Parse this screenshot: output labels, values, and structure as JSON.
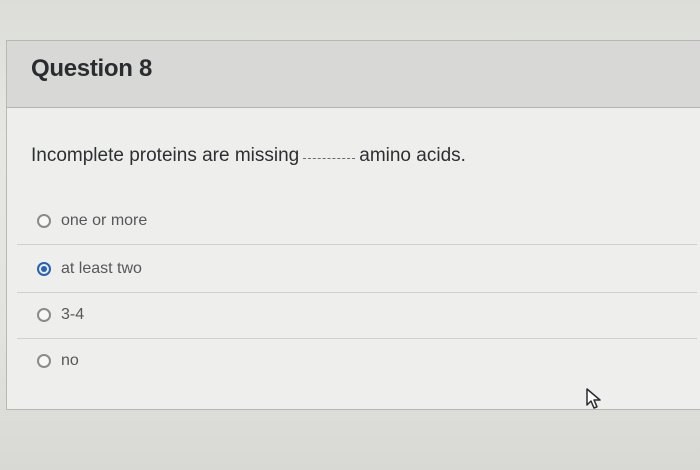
{
  "question": {
    "title": "Question 8",
    "prompt_before": "Incomplete proteins are missing",
    "prompt_after": "amino acids."
  },
  "answers": [
    {
      "label": "one or more",
      "selected": false
    },
    {
      "label": "at least two",
      "selected": true
    },
    {
      "label": "3-4",
      "selected": false
    },
    {
      "label": "no",
      "selected": false
    }
  ],
  "colors": {
    "selected_radio": "#2a5fb6",
    "header_bg": "#d8d9d6"
  },
  "icons": {
    "pointer": "mouse-pointer-icon"
  }
}
